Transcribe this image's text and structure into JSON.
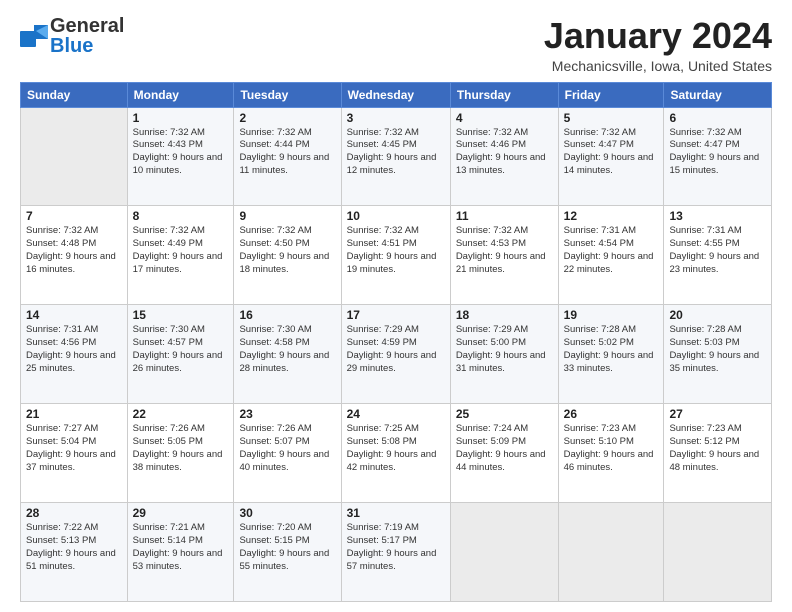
{
  "header": {
    "logo_general": "General",
    "logo_blue": "Blue",
    "month_title": "January 2024",
    "location": "Mechanicsville, Iowa, United States"
  },
  "days_of_week": [
    "Sunday",
    "Monday",
    "Tuesday",
    "Wednesday",
    "Thursday",
    "Friday",
    "Saturday"
  ],
  "weeks": [
    [
      {
        "day": "",
        "empty": true
      },
      {
        "day": "1",
        "sunrise": "Sunrise: 7:32 AM",
        "sunset": "Sunset: 4:43 PM",
        "daylight": "Daylight: 9 hours and 10 minutes."
      },
      {
        "day": "2",
        "sunrise": "Sunrise: 7:32 AM",
        "sunset": "Sunset: 4:44 PM",
        "daylight": "Daylight: 9 hours and 11 minutes."
      },
      {
        "day": "3",
        "sunrise": "Sunrise: 7:32 AM",
        "sunset": "Sunset: 4:45 PM",
        "daylight": "Daylight: 9 hours and 12 minutes."
      },
      {
        "day": "4",
        "sunrise": "Sunrise: 7:32 AM",
        "sunset": "Sunset: 4:46 PM",
        "daylight": "Daylight: 9 hours and 13 minutes."
      },
      {
        "day": "5",
        "sunrise": "Sunrise: 7:32 AM",
        "sunset": "Sunset: 4:47 PM",
        "daylight": "Daylight: 9 hours and 14 minutes."
      },
      {
        "day": "6",
        "sunrise": "Sunrise: 7:32 AM",
        "sunset": "Sunset: 4:47 PM",
        "daylight": "Daylight: 9 hours and 15 minutes."
      }
    ],
    [
      {
        "day": "7",
        "sunrise": "Sunrise: 7:32 AM",
        "sunset": "Sunset: 4:48 PM",
        "daylight": "Daylight: 9 hours and 16 minutes."
      },
      {
        "day": "8",
        "sunrise": "Sunrise: 7:32 AM",
        "sunset": "Sunset: 4:49 PM",
        "daylight": "Daylight: 9 hours and 17 minutes."
      },
      {
        "day": "9",
        "sunrise": "Sunrise: 7:32 AM",
        "sunset": "Sunset: 4:50 PM",
        "daylight": "Daylight: 9 hours and 18 minutes."
      },
      {
        "day": "10",
        "sunrise": "Sunrise: 7:32 AM",
        "sunset": "Sunset: 4:51 PM",
        "daylight": "Daylight: 9 hours and 19 minutes."
      },
      {
        "day": "11",
        "sunrise": "Sunrise: 7:32 AM",
        "sunset": "Sunset: 4:53 PM",
        "daylight": "Daylight: 9 hours and 21 minutes."
      },
      {
        "day": "12",
        "sunrise": "Sunrise: 7:31 AM",
        "sunset": "Sunset: 4:54 PM",
        "daylight": "Daylight: 9 hours and 22 minutes."
      },
      {
        "day": "13",
        "sunrise": "Sunrise: 7:31 AM",
        "sunset": "Sunset: 4:55 PM",
        "daylight": "Daylight: 9 hours and 23 minutes."
      }
    ],
    [
      {
        "day": "14",
        "sunrise": "Sunrise: 7:31 AM",
        "sunset": "Sunset: 4:56 PM",
        "daylight": "Daylight: 9 hours and 25 minutes."
      },
      {
        "day": "15",
        "sunrise": "Sunrise: 7:30 AM",
        "sunset": "Sunset: 4:57 PM",
        "daylight": "Daylight: 9 hours and 26 minutes."
      },
      {
        "day": "16",
        "sunrise": "Sunrise: 7:30 AM",
        "sunset": "Sunset: 4:58 PM",
        "daylight": "Daylight: 9 hours and 28 minutes."
      },
      {
        "day": "17",
        "sunrise": "Sunrise: 7:29 AM",
        "sunset": "Sunset: 4:59 PM",
        "daylight": "Daylight: 9 hours and 29 minutes."
      },
      {
        "day": "18",
        "sunrise": "Sunrise: 7:29 AM",
        "sunset": "Sunset: 5:00 PM",
        "daylight": "Daylight: 9 hours and 31 minutes."
      },
      {
        "day": "19",
        "sunrise": "Sunrise: 7:28 AM",
        "sunset": "Sunset: 5:02 PM",
        "daylight": "Daylight: 9 hours and 33 minutes."
      },
      {
        "day": "20",
        "sunrise": "Sunrise: 7:28 AM",
        "sunset": "Sunset: 5:03 PM",
        "daylight": "Daylight: 9 hours and 35 minutes."
      }
    ],
    [
      {
        "day": "21",
        "sunrise": "Sunrise: 7:27 AM",
        "sunset": "Sunset: 5:04 PM",
        "daylight": "Daylight: 9 hours and 37 minutes."
      },
      {
        "day": "22",
        "sunrise": "Sunrise: 7:26 AM",
        "sunset": "Sunset: 5:05 PM",
        "daylight": "Daylight: 9 hours and 38 minutes."
      },
      {
        "day": "23",
        "sunrise": "Sunrise: 7:26 AM",
        "sunset": "Sunset: 5:07 PM",
        "daylight": "Daylight: 9 hours and 40 minutes."
      },
      {
        "day": "24",
        "sunrise": "Sunrise: 7:25 AM",
        "sunset": "Sunset: 5:08 PM",
        "daylight": "Daylight: 9 hours and 42 minutes."
      },
      {
        "day": "25",
        "sunrise": "Sunrise: 7:24 AM",
        "sunset": "Sunset: 5:09 PM",
        "daylight": "Daylight: 9 hours and 44 minutes."
      },
      {
        "day": "26",
        "sunrise": "Sunrise: 7:23 AM",
        "sunset": "Sunset: 5:10 PM",
        "daylight": "Daylight: 9 hours and 46 minutes."
      },
      {
        "day": "27",
        "sunrise": "Sunrise: 7:23 AM",
        "sunset": "Sunset: 5:12 PM",
        "daylight": "Daylight: 9 hours and 48 minutes."
      }
    ],
    [
      {
        "day": "28",
        "sunrise": "Sunrise: 7:22 AM",
        "sunset": "Sunset: 5:13 PM",
        "daylight": "Daylight: 9 hours and 51 minutes."
      },
      {
        "day": "29",
        "sunrise": "Sunrise: 7:21 AM",
        "sunset": "Sunset: 5:14 PM",
        "daylight": "Daylight: 9 hours and 53 minutes."
      },
      {
        "day": "30",
        "sunrise": "Sunrise: 7:20 AM",
        "sunset": "Sunset: 5:15 PM",
        "daylight": "Daylight: 9 hours and 55 minutes."
      },
      {
        "day": "31",
        "sunrise": "Sunrise: 7:19 AM",
        "sunset": "Sunset: 5:17 PM",
        "daylight": "Daylight: 9 hours and 57 minutes."
      },
      {
        "day": "",
        "empty": true
      },
      {
        "day": "",
        "empty": true
      },
      {
        "day": "",
        "empty": true
      }
    ]
  ]
}
